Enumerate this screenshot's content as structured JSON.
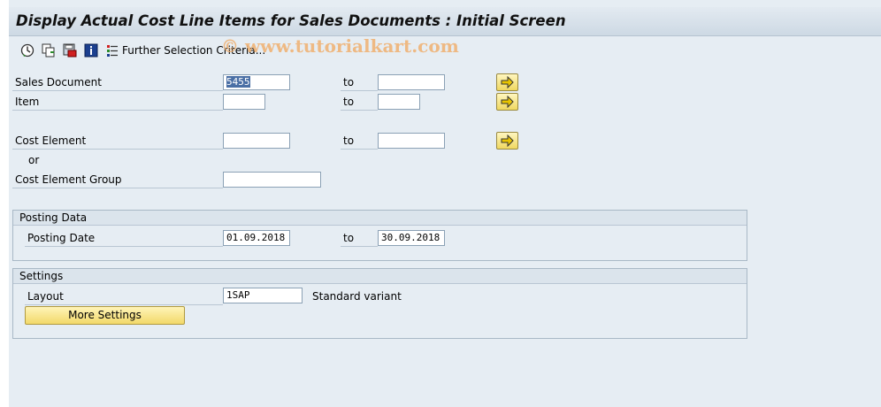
{
  "window": {
    "title": "Display Actual Cost Line Items for Sales Documents : Initial Screen"
  },
  "toolbar": {
    "further_selection_label": "Further Selection Criteria...",
    "watermark": "© www.tutorialkart.com",
    "icons": [
      "execute-icon",
      "copy-icon",
      "save-variant-icon",
      "info-icon",
      "selection-criteria-icon"
    ]
  },
  "selection": {
    "sales_document": {
      "label": "Sales Document",
      "from": "5455",
      "to_label": "to",
      "to": ""
    },
    "item": {
      "label": "Item",
      "from": "",
      "to_label": "to",
      "to": ""
    },
    "cost_element": {
      "label": "Cost Element",
      "from": "",
      "to_label": "to",
      "to": ""
    },
    "or_label": "or",
    "cost_element_group": {
      "label": "Cost Element Group",
      "value": ""
    }
  },
  "posting_data": {
    "title": "Posting Data",
    "posting_date": {
      "label": "Posting Date",
      "from": "01.09.2018",
      "to_label": "to",
      "to": "30.09.2018"
    }
  },
  "settings": {
    "title": "Settings",
    "layout": {
      "label": "Layout",
      "value": "1SAP",
      "description": "Standard variant"
    },
    "more_settings_label": "More Settings"
  },
  "colors": {
    "background": "#e6edf3",
    "button_yellow": "#f2d96a",
    "arrow": "#c8a400"
  }
}
